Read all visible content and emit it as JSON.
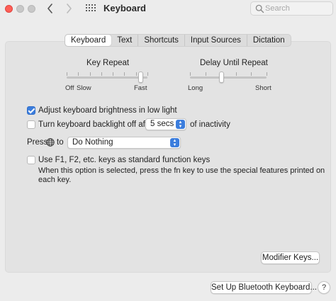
{
  "window": {
    "title": "Keyboard",
    "search_placeholder": "Search"
  },
  "tabs": [
    {
      "label": "Keyboard",
      "active": true
    },
    {
      "label": "Text",
      "active": false
    },
    {
      "label": "Shortcuts",
      "active": false
    },
    {
      "label": "Input Sources",
      "active": false
    },
    {
      "label": "Dictation",
      "active": false
    }
  ],
  "key_repeat": {
    "label": "Key Repeat",
    "left_labels": [
      "Off",
      "Slow"
    ],
    "right_label": "Fast",
    "level": 0.92
  },
  "delay_until_repeat": {
    "label": "Delay Until Repeat",
    "left_label": "Long",
    "right_label": "Short",
    "level": 0.42
  },
  "options": {
    "adjust_brightness": {
      "label": "Adjust keyboard brightness in low light",
      "checked": true
    },
    "backlight_off": {
      "label_before": "Turn keyboard backlight off after",
      "value": "5 secs",
      "label_after": "of inactivity",
      "checked": false
    },
    "press_globe": {
      "label_before": "Press",
      "label_after": "to",
      "value": "Do Nothing"
    },
    "function_keys": {
      "label": "Use F1, F2, etc. keys as standard function keys",
      "description_line1": "When this option is selected, press the fn key to use the special features printed on",
      "description_line2": "each key.",
      "checked": false
    }
  },
  "buttons": {
    "modifier_keys": "Modifier Keys...",
    "bluetooth": "Set Up Bluetooth Keyboard...",
    "help": "?"
  },
  "colors": {
    "accent": "#3b7ddd",
    "close": "#fe5f57"
  }
}
